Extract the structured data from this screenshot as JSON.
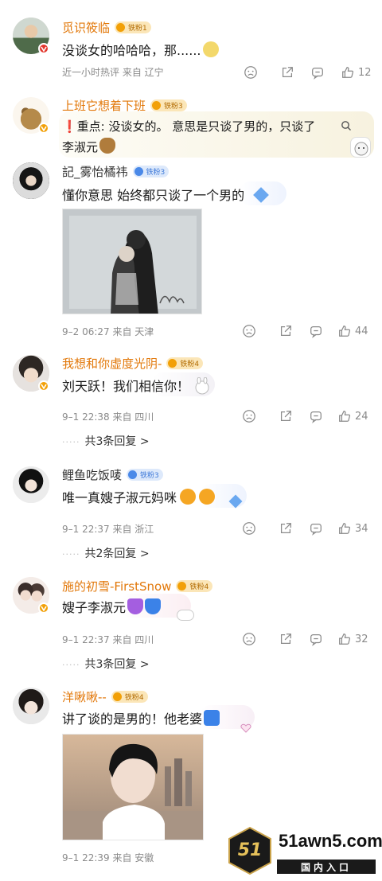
{
  "comments": [
    {
      "username": "觅识筱临",
      "fan_badge": "铁粉1",
      "text": "没谈女的哈哈哈，那......",
      "meta": "近一小时热评  来自 辽宁",
      "likes": "12"
    },
    {
      "username": "上班它想着下班",
      "fan_badge": "铁粉3",
      "text_line1": "❗重点: 没谈女的。  意思是只谈了男的，只谈了",
      "text_line2": "李淑元"
    },
    {
      "username": "記_雾怡橘祎",
      "fan_badge": "铁粉3",
      "text": "懂你意思 始终都只谈了一个男的",
      "meta": "9–2 06:27  来自 天津",
      "likes": "44"
    },
    {
      "username": "我想和你虚度光阴-",
      "fan_badge": "铁粉4",
      "text": "刘天跃！我们相信你！",
      "meta": "9–1 22:38  来自 四川",
      "likes": "24",
      "replies": "共3条回复 >"
    },
    {
      "username": "鲤鱼吃饭唛",
      "fan_badge": "铁粉3",
      "text": "唯一真嫂子淑元妈咪",
      "meta": "9–1 22:37  来自 浙江",
      "likes": "34",
      "replies": "共2条回复 >"
    },
    {
      "username": "施的初雪-FirstSnow",
      "fan_badge": "铁粉4",
      "text": "嫂子李淑元",
      "meta": "9–1 22:37  来自 四川",
      "likes": "32",
      "replies": "共3条回复 >"
    },
    {
      "username": "洋啾啾--",
      "fan_badge": "铁粉4",
      "text": "讲了谈的是男的！他老婆",
      "meta": "9–1 22:39  来自 安徽"
    }
  ],
  "watermark": {
    "logo_text": "51",
    "site": "51awn5.com",
    "subtitle": "国内入口"
  },
  "icons": [
    "sad-face-icon",
    "share-icon",
    "comment-icon",
    "thumbs-up-icon",
    "search-icon",
    "verified-badge-icon"
  ],
  "colors": {
    "orange_name": "#e2780a",
    "meta_gray": "#8a8a8a",
    "gold_badge": "#f2a007",
    "blue_badge": "#4a89e8"
  }
}
